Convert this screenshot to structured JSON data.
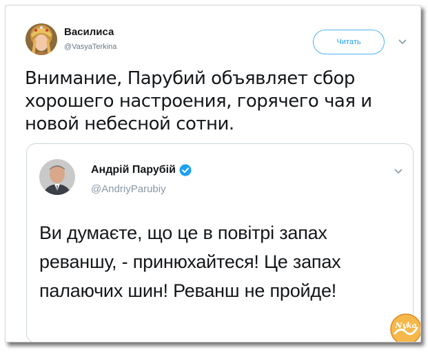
{
  "tweet": {
    "author_name": "Василиса",
    "author_handle": "@VasyaTerkina",
    "follow_label": "Читать",
    "text": "Внимание, Парубий объявляет сбор хорошего настроения, горячего чая и новой небесной сотни."
  },
  "quoted_tweet": {
    "author_name": "Андрій Парубій",
    "author_handle": "@AndriyParubiy",
    "text": "Ви думаєте, що це в повітрі запах реваншу, - принюхайтеся! Це запах палаючих шин! Реванш не пройде!"
  },
  "watermark_text": "Nyka",
  "colors": {
    "accent": "#1da1f2",
    "verified": "#1da1f2",
    "text": "#14171a",
    "secondary": "#657786",
    "border": "#ccd6dd",
    "watermark": "#f0a030"
  },
  "icons": {
    "menu_caret": "chevron-down-icon",
    "verified": "verified-badge-icon"
  }
}
